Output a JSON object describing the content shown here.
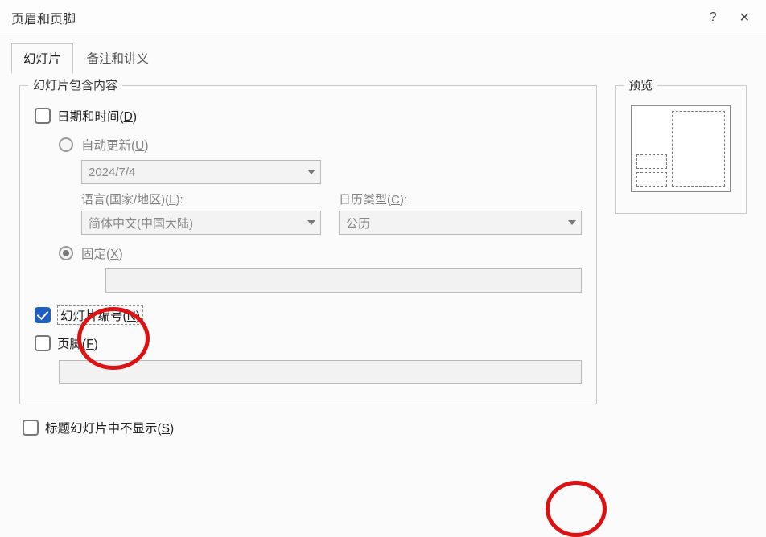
{
  "title": "页眉和页脚",
  "help_btn": "?",
  "close_btn": "✕",
  "tabs": {
    "slide": "幻灯片",
    "notes": "备注和讲义"
  },
  "group": {
    "legend": "幻灯片包含内容",
    "preview_legend": "预览"
  },
  "datetime": {
    "label_pre": "日期和时间(",
    "label_key": "D",
    "label_post": ")",
    "auto_pre": "自动更新(",
    "auto_key": "U",
    "auto_post": ")",
    "date_value": "2024/7/4",
    "lang_label_pre": "语言(国家/地区)(",
    "lang_label_key": "L",
    "lang_label_post": "):",
    "lang_value": "简体中文(中国大陆)",
    "cal_label_pre": "日历类型(",
    "cal_label_key": "C",
    "cal_label_post": "):",
    "cal_value": "公历",
    "fixed_pre": "固定(",
    "fixed_key": "X",
    "fixed_post": ")"
  },
  "slideno": {
    "pre": "幻灯片编号(",
    "key": "N",
    "post": ")"
  },
  "footer": {
    "pre": "页脚(",
    "key": "F",
    "post": ")"
  },
  "hide_on_title": {
    "pre": "标题幻灯片中不显示(",
    "key": "S",
    "post": ")"
  }
}
